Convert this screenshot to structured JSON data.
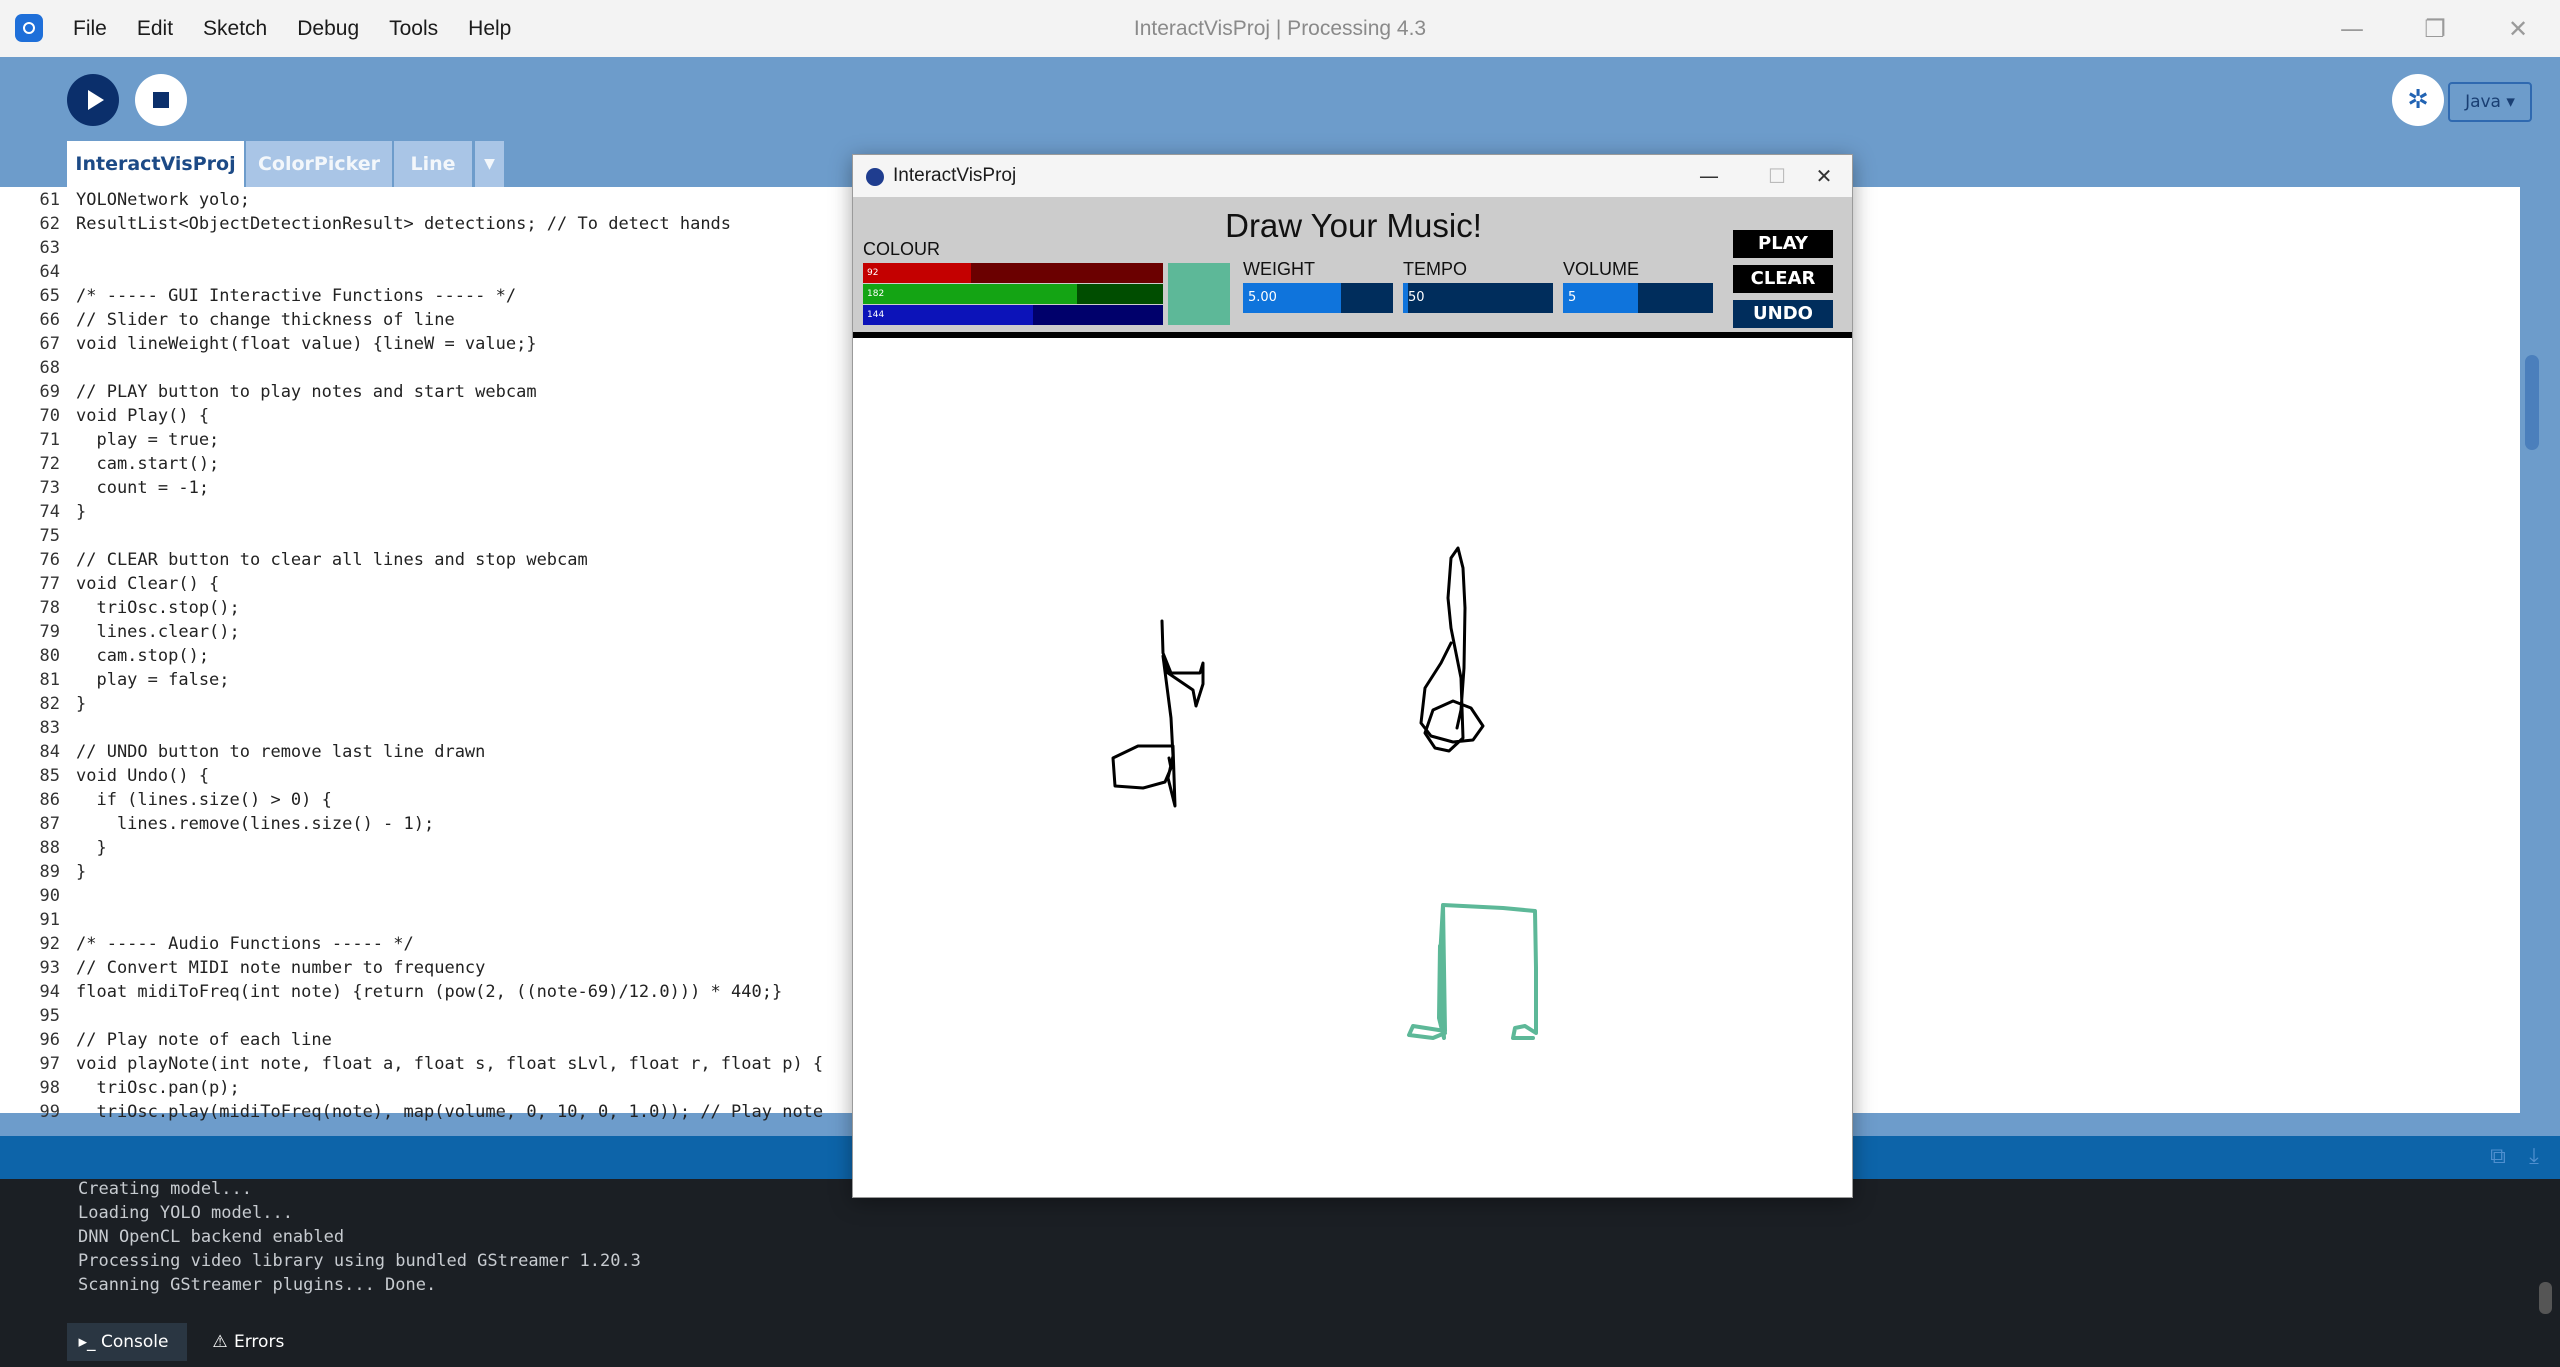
{
  "app": {
    "window_title": "InteractVisProj | Processing 4.3",
    "menu": [
      "File",
      "Edit",
      "Sketch",
      "Debug",
      "Tools",
      "Help"
    ],
    "window_controls": {
      "minimize": "—",
      "maximize": "❐",
      "close": "✕"
    }
  },
  "toolbar": {
    "debug_glyph": "✲",
    "mode_label": "Java ▾"
  },
  "tabs": [
    {
      "label": "InteractVisProj",
      "active": true
    },
    {
      "label": "ColorPicker",
      "active": false
    },
    {
      "label": "Line",
      "active": false
    },
    {
      "label": "▼",
      "active": false
    }
  ],
  "editor": {
    "lines": [
      {
        "num": "61",
        "text": "YOLONetwork yolo;"
      },
      {
        "num": "62",
        "text": "ResultList<ObjectDetectionResult> detections; // To detect hands"
      },
      {
        "num": "63",
        "text": ""
      },
      {
        "num": "64",
        "text": ""
      },
      {
        "num": "65",
        "text": "/* ----- GUI Interactive Functions ----- */"
      },
      {
        "num": "66",
        "text": "// Slider to change thickness of line"
      },
      {
        "num": "67",
        "text": "void lineWeight(float value) {lineW = value;}"
      },
      {
        "num": "68",
        "text": ""
      },
      {
        "num": "69",
        "text": "// PLAY button to play notes and start webcam"
      },
      {
        "num": "70",
        "text": "void Play() {"
      },
      {
        "num": "71",
        "text": "  play = true;"
      },
      {
        "num": "72",
        "text": "  cam.start();"
      },
      {
        "num": "73",
        "text": "  count = -1;"
      },
      {
        "num": "74",
        "text": "}"
      },
      {
        "num": "75",
        "text": ""
      },
      {
        "num": "76",
        "text": "// CLEAR button to clear all lines and stop webcam"
      },
      {
        "num": "77",
        "text": "void Clear() {"
      },
      {
        "num": "78",
        "text": "  triOsc.stop();"
      },
      {
        "num": "79",
        "text": "  lines.clear();"
      },
      {
        "num": "80",
        "text": "  cam.stop();"
      },
      {
        "num": "81",
        "text": "  play = false;"
      },
      {
        "num": "82",
        "text": "}"
      },
      {
        "num": "83",
        "text": ""
      },
      {
        "num": "84",
        "text": "// UNDO button to remove last line drawn"
      },
      {
        "num": "85",
        "text": "void Undo() {"
      },
      {
        "num": "86",
        "text": "  if (lines.size() > 0) {"
      },
      {
        "num": "87",
        "text": "    lines.remove(lines.size() - 1);"
      },
      {
        "num": "88",
        "text": "  }"
      },
      {
        "num": "89",
        "text": "}"
      },
      {
        "num": "90",
        "text": ""
      },
      {
        "num": "91",
        "text": ""
      },
      {
        "num": "92",
        "text": "/* ----- Audio Functions ----- */"
      },
      {
        "num": "93",
        "text": "// Convert MIDI note number to frequency"
      },
      {
        "num": "94",
        "text": "float midiToFreq(int note) {return (pow(2, ((note-69)/12.0))) * 440;}"
      },
      {
        "num": "95",
        "text": ""
      },
      {
        "num": "96",
        "text": "// Play note of each line"
      },
      {
        "num": "97",
        "text": "void playNote(int note, float a, float s, float sLvl, float r, float p) {"
      },
      {
        "num": "98",
        "text": "  triOsc.pan(p);"
      },
      {
        "num": "99",
        "text": "  triOsc.play(midiToFreq(note), map(volume, 0, 10, 0, 1.0)); // Play note"
      }
    ]
  },
  "console": {
    "lines": [
      "Creating model...",
      "Loading YOLO model...",
      "DNN OpenCL backend enabled",
      "Processing video library using bundled GStreamer 1.20.3",
      "Scanning GStreamer plugins... Done."
    ],
    "tabs": {
      "console": "Console",
      "errors": "Errors"
    },
    "icons": {
      "console": "▸_",
      "errors": "⚠"
    }
  },
  "sketch": {
    "title": "InteractVisProj",
    "panel_title": "Draw Your Music!",
    "colour_label": "COLOUR",
    "rgb": [
      {
        "value": "92",
        "fraction": 0.361,
        "track": "#6b0000",
        "fill": "#c40000"
      },
      {
        "value": "182",
        "fraction": 0.714,
        "track": "#004d00",
        "fill": "#14a414"
      },
      {
        "value": "144",
        "fraction": 0.565,
        "track": "#00006b",
        "fill": "#0c13b9"
      }
    ],
    "swatch_color": "#5db898",
    "weight": {
      "label": "WEIGHT",
      "value": "5.00",
      "fraction": 0.65
    },
    "tempo": {
      "label": "TEMPO",
      "value": "50",
      "fraction": 0.03
    },
    "volume": {
      "label": "VOLUME",
      "value": "5",
      "fraction": 0.5
    },
    "buttons": {
      "play": "PLAY",
      "clear": "CLEAR",
      "undo": "UNDO"
    },
    "stroke_colors": {
      "black": "#000000",
      "green": "#5db898"
    }
  }
}
